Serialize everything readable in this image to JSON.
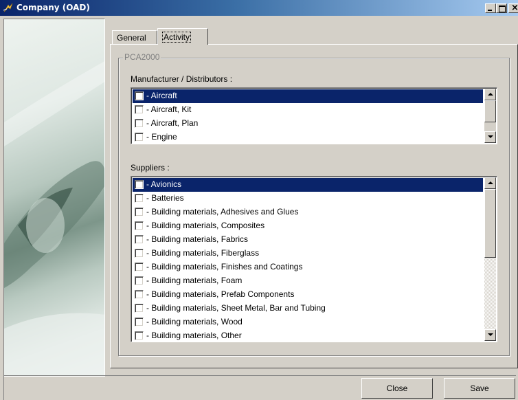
{
  "window": {
    "title": "Company (OAD)",
    "icon": "app-logo-icon",
    "controls": [
      "minimize-icon",
      "maximize-icon",
      "close-icon"
    ]
  },
  "tabs": [
    {
      "label": "General",
      "active": false
    },
    {
      "label": "Activity",
      "active": true
    }
  ],
  "group": {
    "legend": "PCA2000"
  },
  "manufacturers": {
    "label": "Manufacturer / Distributors :",
    "items": [
      {
        "label": "- Aircraft",
        "checked": false,
        "selected": true
      },
      {
        "label": "- Aircraft, Kit",
        "checked": false,
        "selected": false
      },
      {
        "label": "- Aircraft, Plan",
        "checked": false,
        "selected": false
      },
      {
        "label": "- Engine",
        "checked": false,
        "selected": false
      }
    ]
  },
  "suppliers": {
    "label": "Suppliers :",
    "items": [
      {
        "label": "- Avionics",
        "checked": false,
        "selected": true
      },
      {
        "label": "- Batteries",
        "checked": false,
        "selected": false
      },
      {
        "label": "- Building materials, Adhesives and Glues",
        "checked": false,
        "selected": false
      },
      {
        "label": "- Building materials, Composites",
        "checked": false,
        "selected": false
      },
      {
        "label": "- Building materials, Fabrics",
        "checked": false,
        "selected": false
      },
      {
        "label": "- Building materials, Fiberglass",
        "checked": false,
        "selected": false
      },
      {
        "label": "- Building materials, Finishes and Coatings",
        "checked": false,
        "selected": false
      },
      {
        "label": "- Building materials, Foam",
        "checked": false,
        "selected": false
      },
      {
        "label": "- Building materials, Prefab Components",
        "checked": false,
        "selected": false
      },
      {
        "label": "- Building materials, Sheet Metal, Bar and Tubing",
        "checked": false,
        "selected": false
      },
      {
        "label": "- Building materials, Wood",
        "checked": false,
        "selected": false
      },
      {
        "label": "- Building materials, Other",
        "checked": false,
        "selected": false
      }
    ]
  },
  "buttons": {
    "close": "Close",
    "save": "Save"
  },
  "colors": {
    "selection": "#0a246a",
    "face": "#d4d0c8",
    "title_gradient_start": "#0a246a",
    "title_gradient_end": "#a6caf0"
  }
}
